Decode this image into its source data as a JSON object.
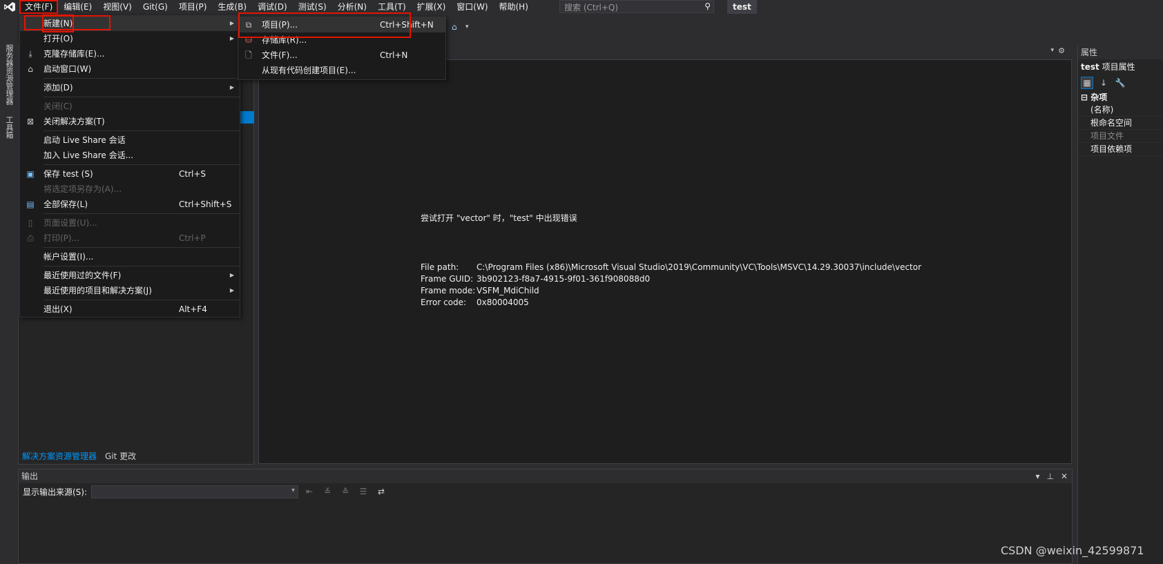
{
  "menubar": {
    "items": [
      "文件(F)",
      "编辑(E)",
      "视图(V)",
      "Git(G)",
      "项目(P)",
      "生成(B)",
      "调试(D)",
      "测试(S)",
      "分析(N)",
      "工具(T)",
      "扩展(X)",
      "窗口(W)",
      "帮助(H)"
    ],
    "search_placeholder": "搜索 (Ctrl+Q)",
    "solution_name": "test"
  },
  "left_strip": {
    "tab1": "服务器资源管理器",
    "tab2": "工具箱"
  },
  "file_menu": {
    "items": [
      {
        "label": "新建(N)",
        "shortcut": "",
        "submenu": true
      },
      {
        "label": "打开(O)",
        "shortcut": "",
        "submenu": true
      },
      {
        "label": "克隆存储库(E)...",
        "shortcut": ""
      },
      {
        "label": "启动窗口(W)",
        "shortcut": ""
      },
      {
        "label": "添加(D)",
        "shortcut": "",
        "submenu": true
      },
      {
        "label": "关闭(C)",
        "shortcut": ""
      },
      {
        "label": "关闭解决方案(T)",
        "shortcut": ""
      },
      {
        "label": "启动 Live Share 会话",
        "shortcut": ""
      },
      {
        "label": "加入 Live Share 会话...",
        "shortcut": ""
      },
      {
        "label": "保存 test (S)",
        "shortcut": "Ctrl+S"
      },
      {
        "label": "将选定项另存为(A)...",
        "shortcut": ""
      },
      {
        "label": "全部保存(L)",
        "shortcut": "Ctrl+Shift+S"
      },
      {
        "label": "页面设置(U)...",
        "shortcut": ""
      },
      {
        "label": "打印(P)...",
        "shortcut": "Ctrl+P"
      },
      {
        "label": "帐户设置(I)...",
        "shortcut": ""
      },
      {
        "label": "最近使用过的文件(F)",
        "shortcut": ""
      },
      {
        "label": "最近使用的项目和解决方案(J)",
        "shortcut": ""
      },
      {
        "label": "退出(X)",
        "shortcut": "Alt+F4"
      }
    ]
  },
  "new_submenu": {
    "items": [
      {
        "label": "项目(P)...",
        "shortcut": "Ctrl+Shift+N"
      },
      {
        "label": "存储库(R)...",
        "shortcut": ""
      },
      {
        "label": "文件(F)...",
        "shortcut": "Ctrl+N"
      },
      {
        "label": "从现有代码创建项目(E)...",
        "shortcut": ""
      }
    ]
  },
  "solution_explorer": {
    "tab_active": "解决方案资源管理器",
    "tab_other": "Git 更改"
  },
  "editor": {
    "error_title": "尝试打开 \"vector\" 时，\"test\" 中出现错误",
    "file_path_label": "File path:",
    "file_path_value": "C:\\Program Files (x86)\\Microsoft Visual Studio\\2019\\Community\\VC\\Tools\\MSVC\\14.29.30037\\include\\vector",
    "frame_guid_label": "Frame GUID:",
    "frame_guid_value": "3b902123-f8a7-4915-9f01-361f908088d0",
    "frame_mode_label": "Frame mode:",
    "frame_mode_value": "VSFM_MdiChild",
    "error_code_label": "Error code:",
    "error_code_value": "0x80004005"
  },
  "properties": {
    "header": "属性",
    "title_name": "test",
    "title_suffix": "项目属性",
    "category": "杂项",
    "rows": [
      "(名称)",
      "根命名空间",
      "项目文件",
      "项目依赖项"
    ]
  },
  "output": {
    "header": "输出",
    "source_label": "显示输出来源(S):",
    "source_value": ""
  },
  "watermark": "CSDN @weixin_42599871"
}
